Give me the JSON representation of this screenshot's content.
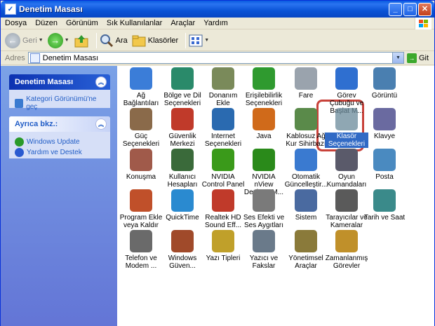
{
  "window": {
    "title": "Denetim Masası",
    "min": "_",
    "max": "□",
    "close": "✕"
  },
  "menu": [
    "Dosya",
    "Düzen",
    "Görünüm",
    "Sık Kullanılanlar",
    "Araçlar",
    "Yardım"
  ],
  "toolbar": {
    "back": "Geri",
    "search": "Ara",
    "folders": "Klasörler"
  },
  "address": {
    "label": "Adres",
    "value": "Denetim Masası",
    "go": "Git"
  },
  "sidebar": {
    "panel1": {
      "title": "Denetim Masası",
      "link": "Kategori Görünümü'ne geç"
    },
    "panel2": {
      "title": "Ayrıca bkz.:",
      "links": [
        "Windows Update",
        "Yardım ve Destek"
      ]
    }
  },
  "items": [
    {
      "label": "Ağ Bağlantıları",
      "icon": "network-connections-icon",
      "color": "#3b7dd8"
    },
    {
      "label": "Bölge ve Dil Seçenekleri",
      "icon": "globe-icon",
      "color": "#2a8a6a"
    },
    {
      "label": "Donanım Ekle",
      "icon": "add-hardware-icon",
      "color": "#7a8a5a"
    },
    {
      "label": "Erişilebilirlik Seçenekleri",
      "icon": "accessibility-icon",
      "color": "#2f9a2f"
    },
    {
      "label": "Fare",
      "icon": "mouse-icon",
      "color": "#9aa3ad"
    },
    {
      "label": "Görev Çubuğu ve Başlat M...",
      "icon": "taskbar-icon",
      "color": "#2f6fd0"
    },
    {
      "label": "Görüntü",
      "icon": "display-icon",
      "color": "#4a7fb0"
    },
    {
      "label": "Güç Seçenekleri",
      "icon": "power-options-icon",
      "color": "#8a6a4a"
    },
    {
      "label": "Güvenlik Merkezi",
      "icon": "shield-icon",
      "color": "#c03a2a"
    },
    {
      "label": "Internet Seçenekleri",
      "icon": "internet-options-icon",
      "color": "#2a6ab0"
    },
    {
      "label": "Java",
      "icon": "java-icon",
      "color": "#d06a1a"
    },
    {
      "label": "Kablosuz Ağ Kur Sihirbazı",
      "icon": "wireless-icon",
      "color": "#5a8a4a"
    },
    {
      "label": "Klasör Seçenekleri",
      "icon": "folder-options-icon",
      "color": "#6a8a9a"
    },
    {
      "label": "Klavye",
      "icon": "keyboard-icon",
      "color": "#6a6aa0"
    },
    {
      "label": "Konuşma",
      "icon": "speech-icon",
      "color": "#a05a4a"
    },
    {
      "label": "Kullanıcı Hesapları",
      "icon": "user-accounts-icon",
      "color": "#3a6a3a"
    },
    {
      "label": "NVIDIA Control Panel",
      "icon": "nvidia-icon",
      "color": "#3a9a1a"
    },
    {
      "label": "NVIDIA nView Desktop M...",
      "icon": "nvidia-nview-icon",
      "color": "#2a8a1a"
    },
    {
      "label": "Otomatik Güncelleştir...",
      "icon": "windows-flag-icon",
      "color": "#3a7ad0"
    },
    {
      "label": "Oyun Kumandaları",
      "icon": "game-controller-icon",
      "color": "#5a5a6a"
    },
    {
      "label": "Posta",
      "icon": "mail-icon",
      "color": "#4a8ac0"
    },
    {
      "label": "Program Ekle veya Kaldır",
      "icon": "add-remove-programs-icon",
      "color": "#c0502a"
    },
    {
      "label": "QuickTime",
      "icon": "quicktime-icon",
      "color": "#2a8ad0"
    },
    {
      "label": "Realtek HD Sound Eff...",
      "icon": "speaker-icon",
      "color": "#c03a2a"
    },
    {
      "label": "Ses Efekti ve Ses Aygıtları",
      "icon": "sound-icon",
      "color": "#7a7a7a"
    },
    {
      "label": "Sistem",
      "icon": "system-icon",
      "color": "#4a6aa0"
    },
    {
      "label": "Tarayıcılar ve Kameralar",
      "icon": "scanner-camera-icon",
      "color": "#5a5a5a"
    },
    {
      "label": "Tarih ve Saat",
      "icon": "clock-icon",
      "color": "#3a8a8a"
    },
    {
      "label": "Telefon ve Modem ...",
      "icon": "phone-modem-icon",
      "color": "#6a6a6a"
    },
    {
      "label": "Windows Güven...",
      "icon": "windows-firewall-icon",
      "color": "#a04a2a"
    },
    {
      "label": "Yazı Tipleri",
      "icon": "fonts-icon",
      "color": "#c0a02a"
    },
    {
      "label": "Yazıcı ve Fakslar",
      "icon": "printer-icon",
      "color": "#6a7a8a"
    },
    {
      "label": "Yönetimsel Araçlar",
      "icon": "admin-tools-icon",
      "color": "#8a7a3a"
    },
    {
      "label": "Zamanlanmış Görevler",
      "icon": "scheduled-tasks-icon",
      "color": "#c0902a"
    }
  ]
}
